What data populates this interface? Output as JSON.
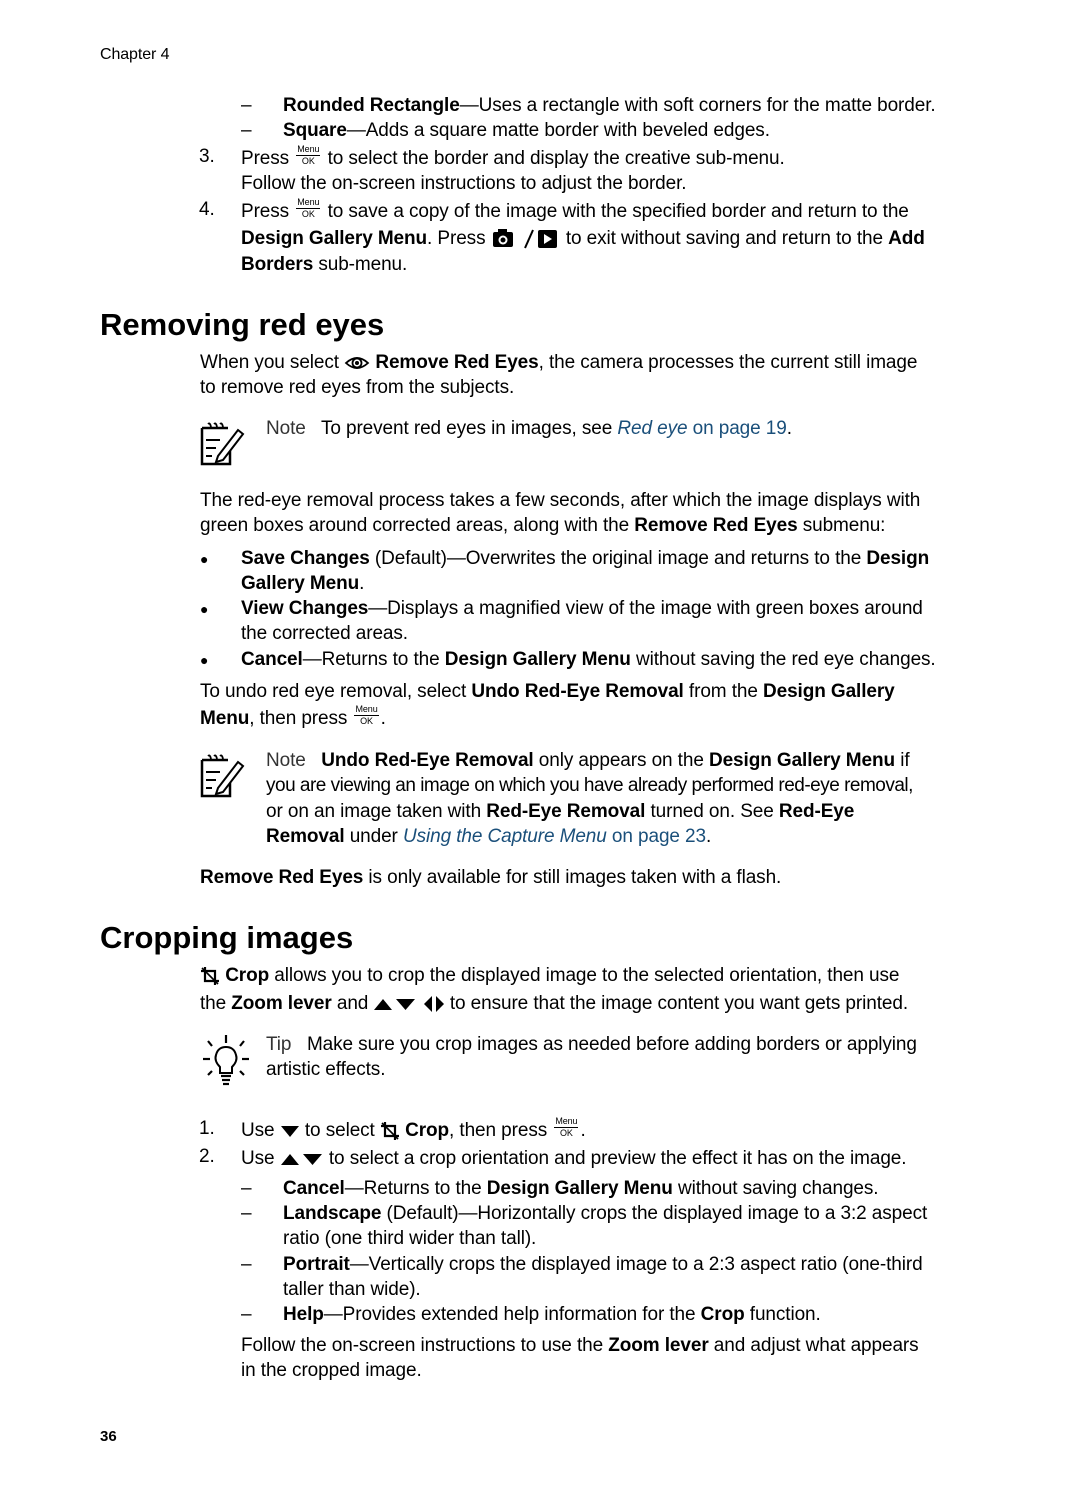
{
  "header": {
    "chapter": "Chapter 4"
  },
  "footer": {
    "page_number": "36"
  },
  "top_section": {
    "dash_items": [
      {
        "bold": "Rounded Rectangle",
        "text": "—Uses a rectangle with soft corners for the matte border."
      },
      {
        "bold": "Square",
        "text": "—Adds a square matte border with beveled edges."
      }
    ],
    "steps": [
      {
        "num": "3.",
        "pre": "Press",
        "post": "to select the border and display the creative sub-menu.",
        "line2": "Follow the on-screen instructions to adjust the border."
      },
      {
        "num": "4.",
        "pre": "Press",
        "post": "to save a copy of the image with the specified border and return to the",
        "line2_bold1": "Design Gallery Menu",
        "line2_mid": ". Press",
        "line2_post": "to exit without saving and return to the",
        "line2_bold2": "Add",
        "line3_bold": "Borders",
        "line3_text": " sub-menu."
      }
    ]
  },
  "menu_ok_icon": {
    "top": "Menu",
    "bottom": "OK"
  },
  "section_red_eyes": {
    "title": "Removing red eyes",
    "intro_pre": "When you select",
    "intro_bold": "Remove Red Eyes",
    "intro_post": ", the camera processes the current still image",
    "intro_line2": "to remove red eyes from the subjects.",
    "note1": {
      "label": "Note",
      "text": "To prevent red eyes in images, see ",
      "link_italic": "Red eye",
      "link_tail": " on page 19",
      "end": "."
    },
    "para2_line1": "The red-eye removal process takes a few seconds, after which the image displays with",
    "para2_line2_pre": "green boxes around corrected areas, along with the ",
    "para2_line2_bold": "Remove Red Eyes",
    "para2_line2_post": " submenu:",
    "bullets": [
      {
        "bold": "Save Changes",
        "text": " (Default)—Overwrites the original image and returns to the ",
        "bold2": "Design",
        "line2_bold": "Gallery Menu",
        "line2_text": "."
      },
      {
        "bold": "View Changes",
        "text": "—Displays a magnified view of the image with green boxes around",
        "line2_text": "the corrected areas."
      },
      {
        "bold": "Cancel",
        "text": "—Returns to the ",
        "bold2": "Design Gallery Menu",
        "text2": " without saving the red eye changes."
      }
    ],
    "undo_pre": "To undo red eye removal, select ",
    "undo_bold": "Undo Red-Eye Removal",
    "undo_mid": " from the ",
    "undo_bold2": "Design Gallery",
    "undo_line2_bold": "Menu",
    "undo_line2_text": ", then press",
    "undo_end": ".",
    "note2": {
      "label": "Note",
      "l1_bold": "Undo Red-Eye Removal",
      "l1_text": " only appears on the ",
      "l1_bold2": "Design Gallery Menu",
      "l1_end": " if",
      "l2": "you are viewing an image on which you have already performed red-eye removal,",
      "l3_pre": "or on an image taken with ",
      "l3_bold": "Red-Eye Removal",
      "l3_mid": " turned on. See ",
      "l3_bold2": "Red-Eye",
      "l4_bold": "Removal",
      "l4_text": " under ",
      "l4_link_italic": "Using the Capture Menu",
      "l4_link_tail": " on page 23",
      "l4_end": "."
    },
    "closing_bold": "Remove Red Eyes",
    "closing_text": " is only available for still images taken with a flash."
  },
  "section_crop": {
    "title": "Cropping images",
    "intro_bold": "Crop",
    "intro_text": " allows you to crop the displayed image to the selected orientation, then use",
    "intro_l2_pre": "the ",
    "intro_l2_bold": "Zoom lever",
    "intro_l2_mid": " and",
    "intro_l2_post": "to ensure that the image content you want gets printed.",
    "tip": {
      "label": "Tip",
      "text": "Make sure you crop images as needed before adding borders or applying",
      "line2": "artistic effects."
    },
    "steps": [
      {
        "num": "1.",
        "pre": "Use",
        "mid": "to select",
        "bold": "Crop",
        "post": ", then press",
        "end": "."
      },
      {
        "num": "2.",
        "pre": "Use",
        "post": "to select a crop orientation and preview the effect it has on the image."
      }
    ],
    "options": [
      {
        "bold": "Cancel",
        "text": "—Returns to the ",
        "bold2": "Design Gallery Menu",
        "text2": " without saving changes."
      },
      {
        "bold": "Landscape",
        "text": " (Default)—Horizontally crops the displayed image to a 3:2 aspect",
        "line2": "ratio (one third wider than tall)."
      },
      {
        "bold": "Portrait",
        "text": "—Vertically crops the displayed image to a 2:3 aspect ratio (one-third",
        "line2": "taller than wide)."
      },
      {
        "bold": "Help",
        "text": "—Provides extended help information for the ",
        "bold2": "Crop",
        "text2": " function."
      }
    ],
    "closing_pre": "Follow the on-screen instructions to use the ",
    "closing_bold": "Zoom lever",
    "closing_post": " and adjust what appears",
    "closing_line2": "in the cropped image."
  },
  "symbols": {
    "dash": "–",
    "bullet": "●"
  }
}
